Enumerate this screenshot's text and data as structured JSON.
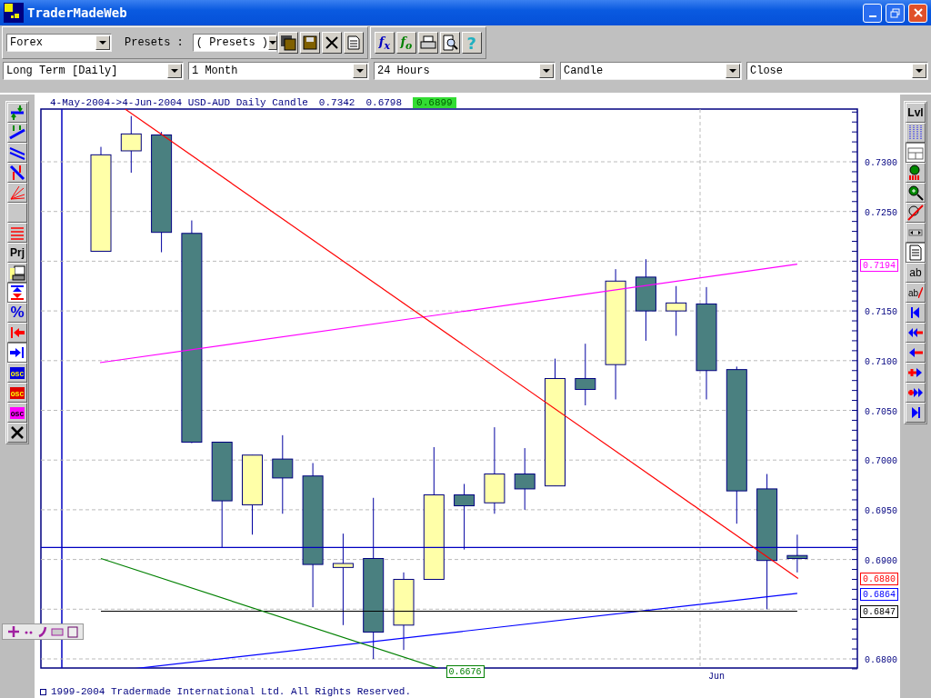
{
  "window": {
    "title": "TraderMadeWeb"
  },
  "toolbar": {
    "market": "Forex",
    "presets_label": "Presets :",
    "presets": "( Presets )",
    "formula_buttons": [
      "f$_{x}$",
      "f$_{o}$"
    ],
    "help": "?"
  },
  "selectors": [
    "Long Term [Daily]",
    "1 Month",
    "24 Hours",
    "Candle",
    "Close"
  ],
  "chart_header": {
    "title": "4-May-2004->4-Jun-2004 USD-AUD Daily Candle",
    "high": "0.7342",
    "low": "0.6798",
    "last": "0.6899"
  },
  "left_tools": [
    {
      "selected": false
    },
    {
      "selected": false
    },
    {
      "selected": false
    },
    {
      "selected": false
    },
    {
      "selected": false
    },
    {
      "selected": false
    },
    {
      "selected": false
    },
    {
      "label": "Prj",
      "selected": false
    },
    {
      "selected": false
    },
    {
      "selected": true
    },
    {
      "label": "%",
      "selected": false
    },
    {
      "selected": false
    },
    {
      "selected": true
    },
    {
      "label": "OSC",
      "selected": false
    },
    {
      "label": "OSC",
      "selected": false
    },
    {
      "label": "OSC",
      "selected": false
    },
    {
      "selected": false
    }
  ],
  "right_tools": [
    {
      "label": "Lvl",
      "selected": false
    },
    {
      "selected": false
    },
    {
      "selected": true
    },
    {
      "selected": false
    },
    {
      "selected": false
    },
    {
      "selected": false
    },
    {
      "selected": false
    },
    {
      "selected": true
    },
    {
      "label": "ab",
      "selected": false
    },
    {
      "label": "ab",
      "selected": false
    },
    {
      "selected": false
    },
    {
      "selected": false
    },
    {
      "selected": false
    },
    {
      "selected": false
    },
    {
      "selected": false
    },
    {
      "selected": false
    }
  ],
  "chart": {
    "price_labels": [
      "0.7300",
      "0.7250",
      "0.7150",
      "0.7100",
      "0.7050",
      "0.7000",
      "0.6950",
      "0.6900",
      "0.6800"
    ],
    "month_label": "Jun",
    "price_tags": [
      {
        "label": "0.7194",
        "color": "#ff00ff"
      },
      {
        "label": "0.6880",
        "color": "#ff0000"
      },
      {
        "label": "0.6864",
        "color": "#0000ff"
      },
      {
        "label": "0.6847",
        "color": "#000000"
      },
      {
        "label": "0.6676",
        "color": "#008000"
      }
    ]
  },
  "footer": "1999-2004 Tradermade International Ltd. All Rights Reserved."
}
